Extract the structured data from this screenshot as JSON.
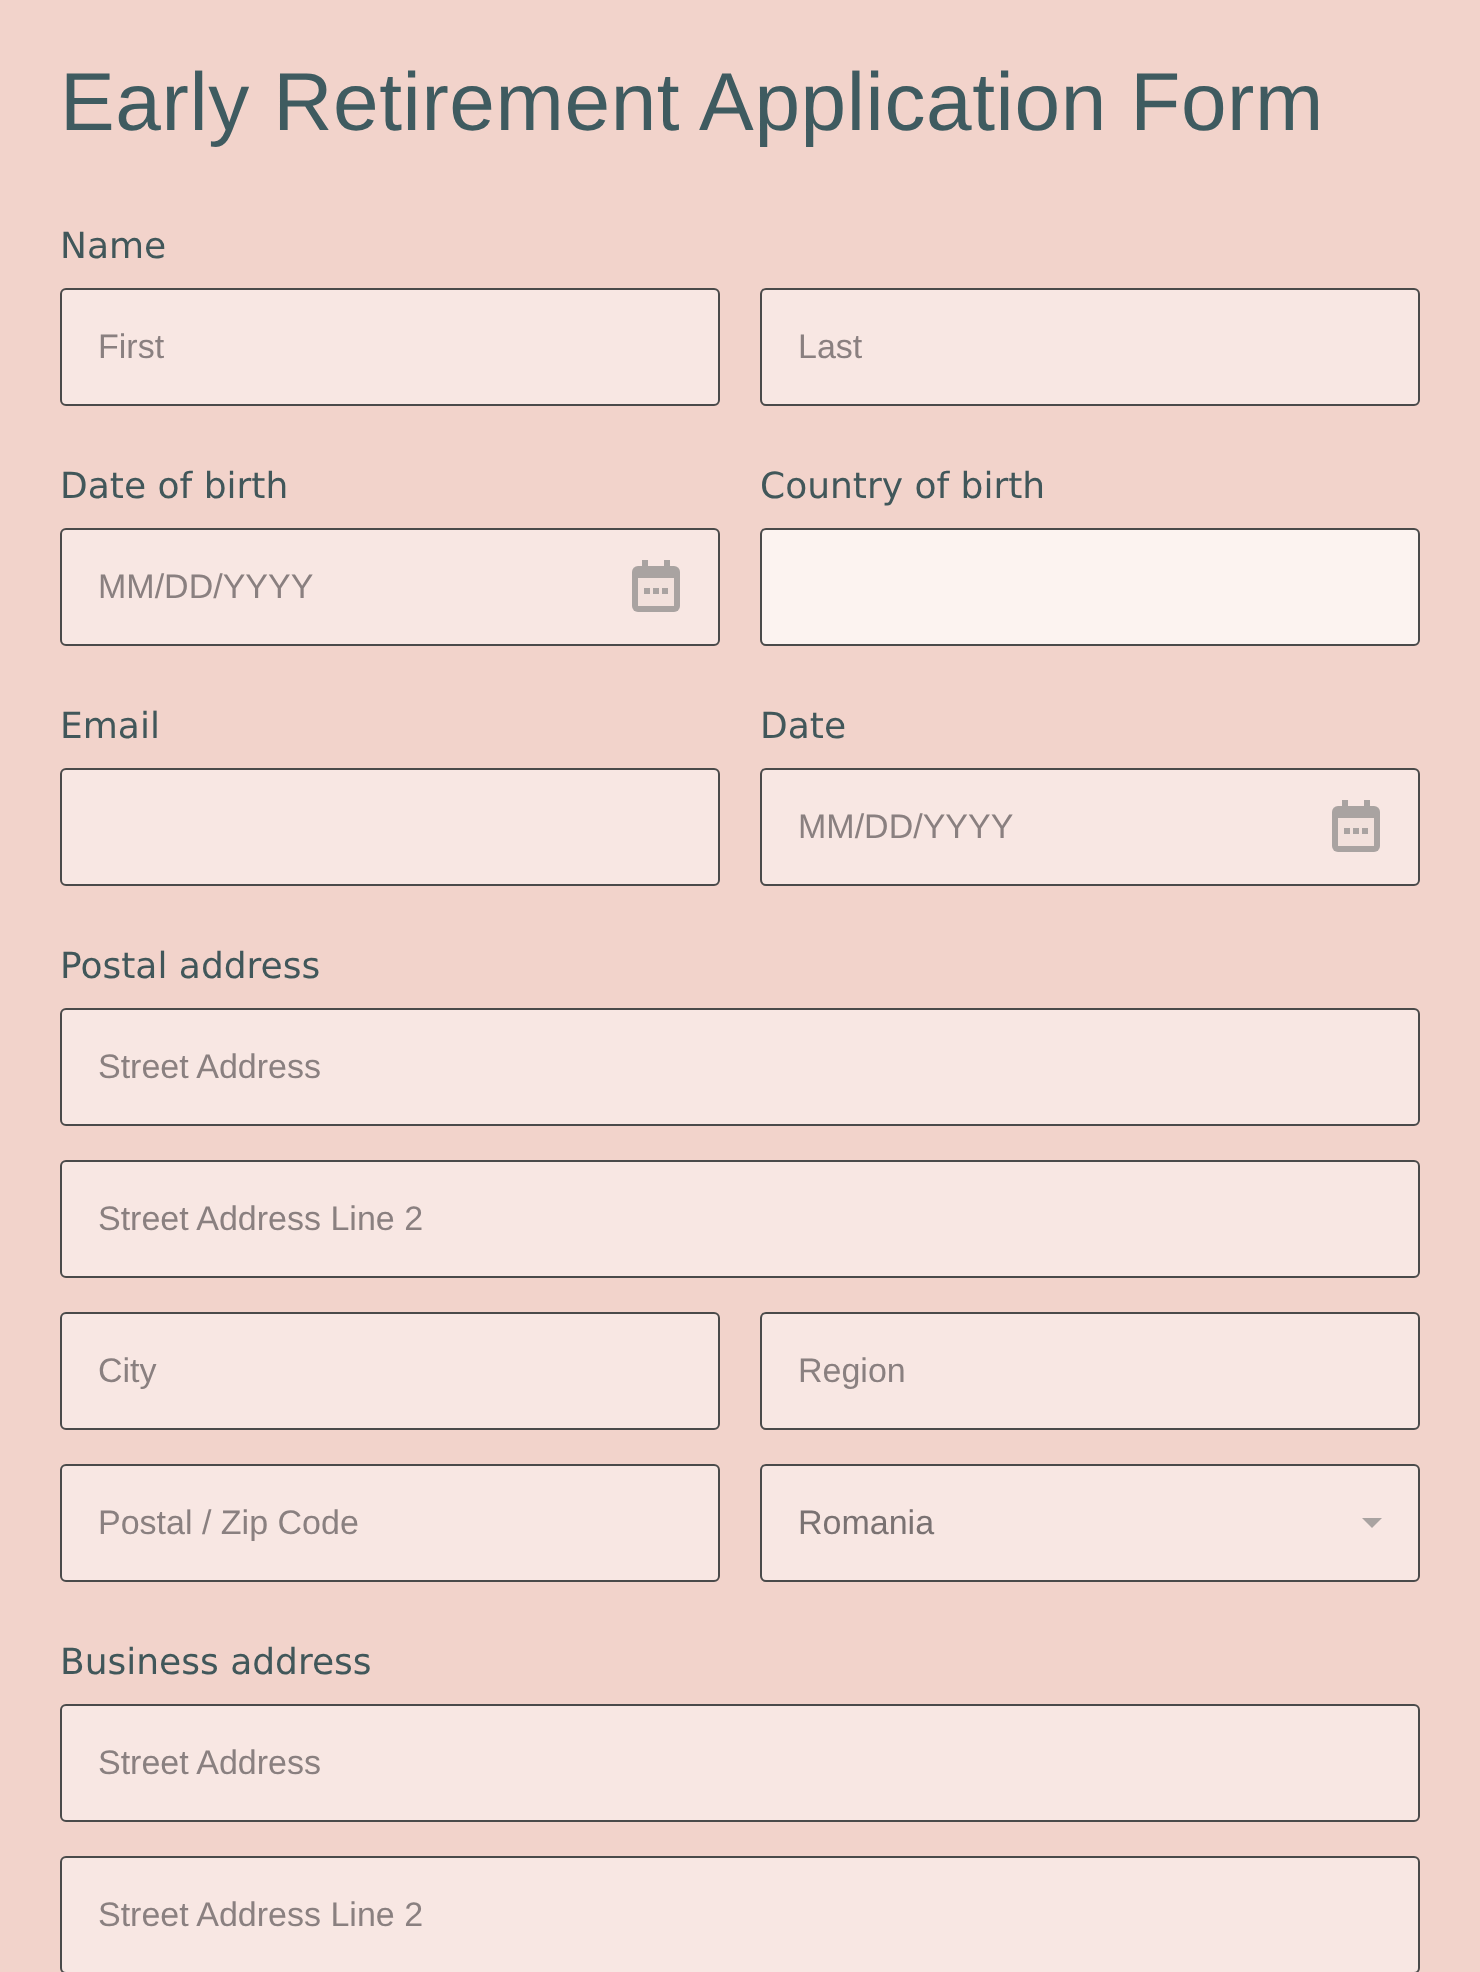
{
  "title": "Early Retirement Application Form",
  "sections": [
    {
      "rows": [
        {
          "label": "Name",
          "fields": [
            {
              "kind": "text",
              "placeholder": "First",
              "focused": false
            },
            {
              "kind": "text",
              "placeholder": "Last",
              "focused": false
            }
          ]
        }
      ]
    },
    {
      "rows": [
        {
          "cols": [
            {
              "label": "Date of birth",
              "field": {
                "kind": "date",
                "placeholder": "MM/DD/YYYY",
                "focused": false
              }
            },
            {
              "label": "Country of birth",
              "field": {
                "kind": "text",
                "focused": true
              }
            }
          ]
        }
      ]
    },
    {
      "rows": [
        {
          "cols": [
            {
              "label": "Email",
              "field": {
                "kind": "text",
                "focused": false
              }
            },
            {
              "label": "Date",
              "field": {
                "kind": "date",
                "placeholder": "MM/DD/YYYY",
                "focused": false
              }
            }
          ]
        }
      ]
    },
    {
      "rows": [
        {
          "label": "Postal address",
          "fields": [
            {
              "kind": "text",
              "placeholder": "Street Address",
              "focused": false
            }
          ]
        },
        {
          "fields": [
            {
              "kind": "text",
              "placeholder": "Street Address Line 2",
              "focused": false
            }
          ]
        },
        {
          "fields": [
            {
              "kind": "text",
              "placeholder": "City",
              "focused": false
            },
            {
              "kind": "text",
              "placeholder": "Region",
              "focused": false
            }
          ]
        },
        {
          "fields": [
            {
              "kind": "text",
              "placeholder": "Postal / Zip Code",
              "focused": false
            },
            {
              "kind": "select",
              "value": "Romania",
              "focused": false
            }
          ]
        }
      ]
    },
    {
      "rows": [
        {
          "label": "Business address",
          "fields": [
            {
              "kind": "text",
              "placeholder": "Street Address",
              "focused": false
            }
          ]
        },
        {
          "fields": [
            {
              "kind": "text",
              "placeholder": "Street Address Line 2",
              "focused": false
            }
          ]
        }
      ]
    }
  ]
}
